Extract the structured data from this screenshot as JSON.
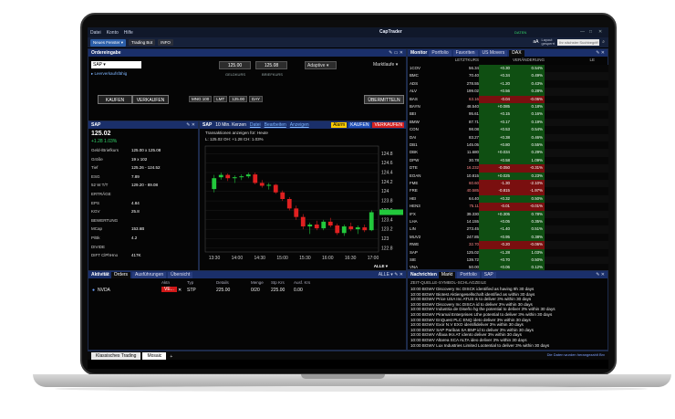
{
  "app": {
    "title": "CapTrader",
    "status": "DATEN"
  },
  "menu": [
    "Datei",
    "Konto",
    "Hilfe"
  ],
  "toolbar": {
    "new_window": "Neues Fenster ▾",
    "trading_bot": "Trading Bot",
    "info": "INFO",
    "search_placeholder": "Ihr nächster Suchbegriff",
    "layout_label": "Layout\ngesperrt"
  },
  "order_entry": {
    "title": "Ordereingabe",
    "symbol": "SAP",
    "link": "▸ Leerverkaufsfähig",
    "bid": "125.00",
    "ask": "125.08",
    "bid_label": "GELDKURS",
    "ask_label": "BRIEFKURS",
    "algo": "Adaptive",
    "order_type": "Marktlaufe",
    "buy": "KAUFEN",
    "sell": "VERKAUFEN",
    "qty": "MNG 100",
    "type": "LMT",
    "limit_price": "125.00",
    "tif": "DAY",
    "submit": "ÜBERMITTELN"
  },
  "quote": {
    "title": "SAP",
    "price": "125.02",
    "change": "+1.28  1.03%",
    "rows": [
      [
        "Geld-/Briefkurs",
        "125.00 x 125.08"
      ],
      [
        "Größe",
        "19 x 102"
      ],
      [
        "Tief",
        "125.26 - 124.52"
      ],
      [
        "ESG",
        "7.89"
      ],
      [
        "52 W T/T",
        "129.20 - 89.08"
      ],
      [
        "ERTRÄGE",
        ""
      ],
      [
        "EPS",
        "4.84"
      ],
      [
        "KGV",
        "25.8"
      ],
      [
        "BEWERTUNG",
        ""
      ],
      [
        "MCap",
        "153.6B"
      ],
      [
        "P/Bk",
        "4.2"
      ],
      [
        "DIVIDE",
        ""
      ],
      [
        "DIFT ClPhHno",
        "417K"
      ]
    ]
  },
  "chart": {
    "title": "SAP",
    "interval": "10 Min. Kerzen",
    "menu": [
      "Datei",
      "Bearbeiten",
      "Anzeigen"
    ],
    "alarm": "Alarm",
    "kauf": "KAUFEN",
    "verk": "VERKAUFEN",
    "legend1": "Transaktionen anzeigen für: Heute",
    "legend2": "L: 125.02 OH: +1.28 CH: 1.03%",
    "footer": "ALLE ▾"
  },
  "chart_data": {
    "type": "candlestick",
    "x_labels": [
      "13:30",
      "14:00",
      "14:30",
      "15:00",
      "15:30",
      "16:00",
      "16:30",
      "17:00"
    ],
    "y_ticks": [
      124.8,
      124.6,
      124.4,
      124.2,
      124.0,
      123.8,
      123.6,
      123.4,
      123.2,
      123.0,
      122.8
    ],
    "ylim": [
      122.72,
      124.96
    ],
    "candles": [
      [
        124.05,
        124.35,
        123.98,
        124.28
      ],
      [
        124.3,
        124.4,
        124.25,
        124.35
      ],
      [
        124.35,
        124.38,
        124.22,
        124.28
      ],
      [
        124.28,
        124.34,
        124.18,
        124.3
      ],
      [
        124.3,
        124.36,
        124.24,
        124.32
      ],
      [
        124.32,
        124.4,
        124.28,
        124.36
      ],
      [
        124.36,
        124.4,
        124.15,
        124.18
      ],
      [
        124.18,
        124.24,
        124.08,
        124.12
      ],
      [
        124.12,
        124.18,
        124.04,
        124.14
      ],
      [
        124.14,
        124.16,
        123.95,
        123.98
      ],
      [
        123.98,
        124.02,
        123.8,
        123.84
      ],
      [
        123.84,
        123.88,
        123.6,
        123.64
      ],
      [
        123.64,
        123.7,
        123.4,
        123.46
      ],
      [
        123.46,
        123.52,
        123.2,
        123.26
      ],
      [
        123.26,
        123.34,
        123.1,
        123.3
      ],
      [
        123.3,
        123.38,
        123.18,
        123.22
      ],
      [
        123.22,
        123.4,
        123.18,
        123.36
      ],
      [
        123.36,
        123.44,
        123.24,
        123.28
      ],
      [
        123.28,
        123.32,
        123.08,
        123.12
      ],
      [
        123.12,
        123.3,
        123.06,
        123.26
      ],
      [
        123.26,
        123.34,
        123.16,
        123.2
      ],
      [
        123.2,
        123.28,
        123.1,
        123.24
      ],
      [
        123.24,
        123.3,
        123.14,
        123.18
      ],
      [
        123.18,
        123.6,
        123.16,
        123.56
      ]
    ]
  },
  "monitor": {
    "title": "Monitor",
    "tabs": [
      "Portfolio",
      "Favoriten",
      "US Movers",
      "DAX"
    ],
    "headers": [
      "LETZTKURS",
      "VERÄNDERUNG",
      "LE"
    ],
    "rows": [
      [
        "1COV",
        "56.34",
        "+0.30",
        "0.54%"
      ],
      [
        "BMC",
        "70.40",
        "+0.34",
        "0.49%"
      ],
      [
        "ADS",
        "278.55",
        "+1.20",
        "0.43%"
      ],
      [
        "ALV",
        "199.02",
        "+0.56",
        "0.28%"
      ],
      [
        "BAS",
        "63.16",
        "-0.04",
        "-0.06%"
      ],
      [
        "BAYN",
        "48.540",
        "+0.085",
        "0.18%"
      ],
      [
        "BEI",
        "95.61",
        "+0.15",
        "0.16%"
      ],
      [
        "BMW",
        "87.71",
        "+0.17",
        "0.19%"
      ],
      [
        "CON",
        "98.08",
        "+0.53",
        "0.54%"
      ],
      [
        "DAI",
        "83.27",
        "+0.38",
        "0.46%"
      ],
      [
        "DB1",
        "145.05",
        "+0.80",
        "0.55%"
      ],
      [
        "DBK",
        "11.680",
        "+0.034",
        "0.29%"
      ],
      [
        "DPW",
        "30.78",
        "+0.58",
        "1.09%"
      ],
      [
        "DTE",
        "16.232",
        "-0.050",
        "-0.31%"
      ],
      [
        "EOAN",
        "10.815",
        "+0.025",
        "0.23%"
      ],
      [
        "FME",
        "60.60",
        "-1.30",
        "-2.10%"
      ],
      [
        "FRE",
        "40.585",
        "-0.815",
        "-1.97%"
      ],
      [
        "HEI",
        "64.40",
        "+0.32",
        "0.50%"
      ],
      [
        "HEN3",
        "75.11",
        "-0.01",
        "-0.01%"
      ],
      [
        "IFX",
        "39.330",
        "+0.305",
        "0.78%"
      ],
      [
        "LHA",
        "14.155",
        "+0.05",
        "0.35%"
      ],
      [
        "LIN",
        "273.45",
        "+1.40",
        "0.51%"
      ],
      [
        "MUV2",
        "247.85",
        "+0.95",
        "0.38%"
      ],
      [
        "RWE",
        "32.70",
        "-0.20",
        "-0.06%"
      ],
      [
        "SAP",
        "125.02",
        "+1.28",
        "1.03%"
      ],
      [
        "SIE",
        "139.72",
        "+0.70",
        "0.50%"
      ],
      [
        "VNA",
        "50.00",
        "+0.06",
        "0.12%"
      ],
      [
        "VOW3",
        "174.00",
        "-0.55",
        "-0.32%"
      ],
      [
        "WDI",
        "0.1922",
        "+0.0008",
        "0.42%"
      ],
      [
        "MTX",
        "180.60",
        "-0.55",
        "-0.30%"
      ]
    ]
  },
  "activity": {
    "title": "Aktivität",
    "tabs": [
      "Orders",
      "Ausführungen",
      "Übersicht"
    ],
    "columns": [
      "Aktn",
      "Typ",
      "Details",
      "Menge",
      "Stp Krs",
      "Ausf. Krs"
    ],
    "row": {
      "symbol": "NVDA",
      "action": "VE...",
      "type": "STP",
      "details": "225.00",
      "qty": "0/20",
      "stp": "225.00",
      "fill": "0.00"
    },
    "footer": "ALLE ▾"
  },
  "news": {
    "title": "Nachrichten",
    "tabs": [
      "Markt",
      "Portfolio",
      "SAP"
    ],
    "header": "ZEIT-QUELLE-SYMBOL-SCHLAGZEILE",
    "lines": [
      "10:00 BGWV Discovery Inc DISCK identified as having 9h 30 days",
      "10:00 BGWV Biotest Aktiengesellschaft identified as within 30 days",
      "10:00 BGWV Price USA Inc ATUS is to deliver 3% within 30 days",
      "10:00 BGWV Discovery Inc DISCA id to deliver 3% within 30 days",
      "10:00 BGWV Industria de Diseño hg the potential to deliver 3% within 30 days",
      "10:00 BGWV Piramal Enterprises Lthe potential to deliver 3% within 30 days",
      "10:00 BGWV EnQuest PLC ENQ ideto deliver 3% within 30 days",
      "10:00 BGWV Exor N.V EXO identifideliver 3% within 30 days",
      "10:00 BGWV SAP Paribas SA BNP id to deliver 3% within 30 days",
      "10:00 BGWV Alfaxa IKs AT idento deliver 3% within 30 days",
      "10:00 BGWV Altarea SCA ALTA ideo deliver 3% within 30 days",
      "10:00 BGWV Lux Industries Limited Lootential to deliver 3% within 30 days"
    ]
  },
  "bottom": {
    "tabs": [
      "Klassisches Trading",
      "Mosaic"
    ],
    "status": "Die Daten wurden herangezahlt Brv"
  },
  "colors": {
    "up": "#22c83c",
    "down": "#e02020",
    "pos_bg": "#0f4f12",
    "neg_bg": "#7a0f0f",
    "accent": "#1a2f6a"
  }
}
